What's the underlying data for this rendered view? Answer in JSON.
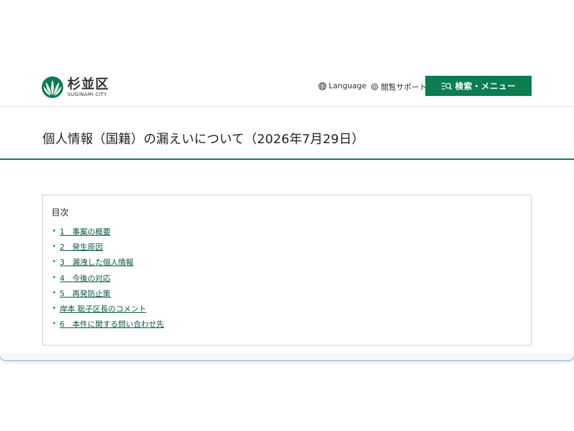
{
  "header": {
    "logo_text": "杉並区",
    "logo_sub": "SUGINAMI CITY",
    "language_label": "Language",
    "support_label": "閲覧サポート",
    "menu_button_label": "検索・メニュー"
  },
  "page": {
    "title": "個人情報（国籍）の漏えいについて（2026年7月29日）"
  },
  "toc": {
    "heading": "目次",
    "items": [
      {
        "label": "1　事案の概要"
      },
      {
        "label": "2　発生原因"
      },
      {
        "label": "3　漏洩した個人情報"
      },
      {
        "label": "4　今後の対応"
      },
      {
        "label": "5　再発防止策"
      },
      {
        "label": "岸本 聡子区長のコメント"
      },
      {
        "label": "6　本件に関する問い合わせ先"
      }
    ]
  },
  "colors": {
    "brand_green": "#0b7d4e",
    "link_green": "#0b5a36"
  }
}
